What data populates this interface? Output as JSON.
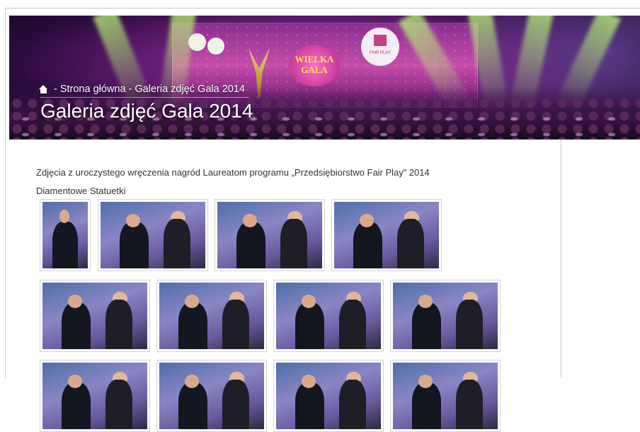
{
  "banner": {
    "breadcrumb": {
      "home_icon": "home-icon",
      "separator": "-",
      "home_label": "Strona główna",
      "current_label": "Galeria zdjęć Gala 2014"
    },
    "page_title": "Galeria zdjęć Gala 2014",
    "scene": {
      "gala_sign": "WIELKA\nGALA",
      "fair_play_sign": "FAIR PLAY"
    }
  },
  "content": {
    "intro": "Zdjęcia z uroczystego wręczenia nagród Laureatom programu „Przedsiębiorstwo Fair Play” 2014",
    "section_title": "Diamentowe Statuetki",
    "gallery_rows": [
      {
        "count": 4
      },
      {
        "count": 4
      },
      {
        "count": 4
      }
    ]
  }
}
